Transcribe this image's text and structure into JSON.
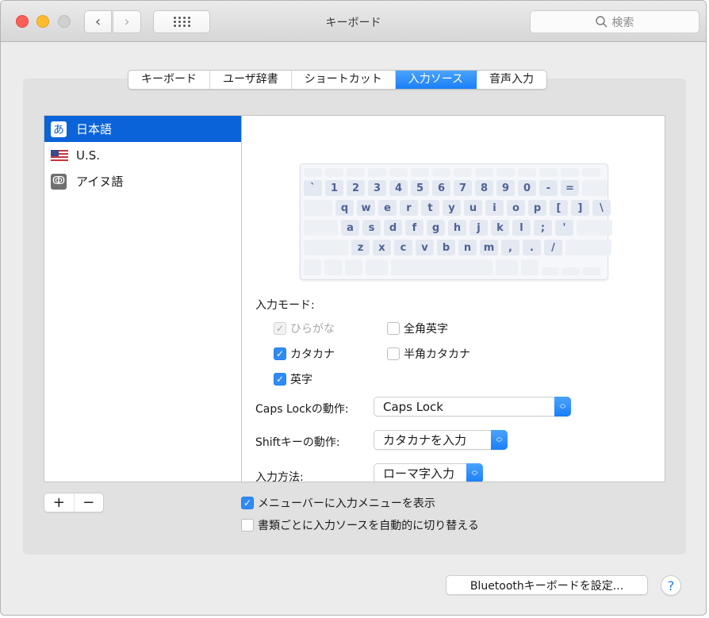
{
  "window": {
    "title": "キーボード",
    "search_placeholder": "検索",
    "nav_back_glyph": "‹",
    "nav_forward_glyph": "›"
  },
  "tabs": [
    {
      "label": "キーボード",
      "active": false
    },
    {
      "label": "ユーザ辞書",
      "active": false
    },
    {
      "label": "ショートカット",
      "active": false
    },
    {
      "label": "入力ソース",
      "active": true
    },
    {
      "label": "音声入力",
      "active": false
    }
  ],
  "sources": [
    {
      "label": "日本語",
      "icon": "hiragana-a-icon",
      "glyph": "あ",
      "selected": true
    },
    {
      "label": "U.S.",
      "icon": "us-flag-icon",
      "glyph": "",
      "selected": false
    },
    {
      "label": "アイヌ語",
      "icon": "ainu-icon",
      "glyph": "ↂ",
      "selected": false
    }
  ],
  "keyboard": {
    "row1": [
      "`",
      "1",
      "2",
      "3",
      "4",
      "5",
      "6",
      "7",
      "8",
      "9",
      "0",
      "-",
      "="
    ],
    "row2": [
      "q",
      "w",
      "e",
      "r",
      "t",
      "y",
      "u",
      "i",
      "o",
      "p",
      "[",
      "]",
      "\\"
    ],
    "row3": [
      "a",
      "s",
      "d",
      "f",
      "g",
      "h",
      "j",
      "k",
      "l",
      ";",
      "'"
    ],
    "row4": [
      "z",
      "x",
      "c",
      "v",
      "b",
      "n",
      "m",
      ",",
      ".",
      "/"
    ]
  },
  "input_modes": {
    "label": "入力モード:",
    "options": [
      {
        "label": "ひらがな",
        "checked": true,
        "disabled": true
      },
      {
        "label": "全角英字",
        "checked": false,
        "disabled": false
      },
      {
        "label": "カタカナ",
        "checked": true,
        "disabled": false
      },
      {
        "label": "半角カタカナ",
        "checked": false,
        "disabled": false
      },
      {
        "label": "英字",
        "checked": true,
        "disabled": false
      }
    ]
  },
  "settings": {
    "caps_lock_label": "Caps Lockの動作:",
    "caps_lock_value": "Caps Lock",
    "shift_label": "Shiftキーの動作:",
    "shift_value": "カタカナを入力",
    "method_label": "入力方法:",
    "method_value": "ローマ字入力"
  },
  "list_buttons": {
    "add": "+",
    "remove": "−"
  },
  "options": {
    "show_menu": {
      "label": "メニューバーに入力メニューを表示",
      "checked": true
    },
    "auto_switch": {
      "label": "書類ごとに入力ソースを自動的に切り替える",
      "checked": false
    }
  },
  "footer": {
    "bluetooth_button": "Bluetoothキーボードを設定...",
    "help": "?"
  },
  "colors": {
    "accent": "#1a7ff6",
    "selection": "#0a63d9"
  }
}
